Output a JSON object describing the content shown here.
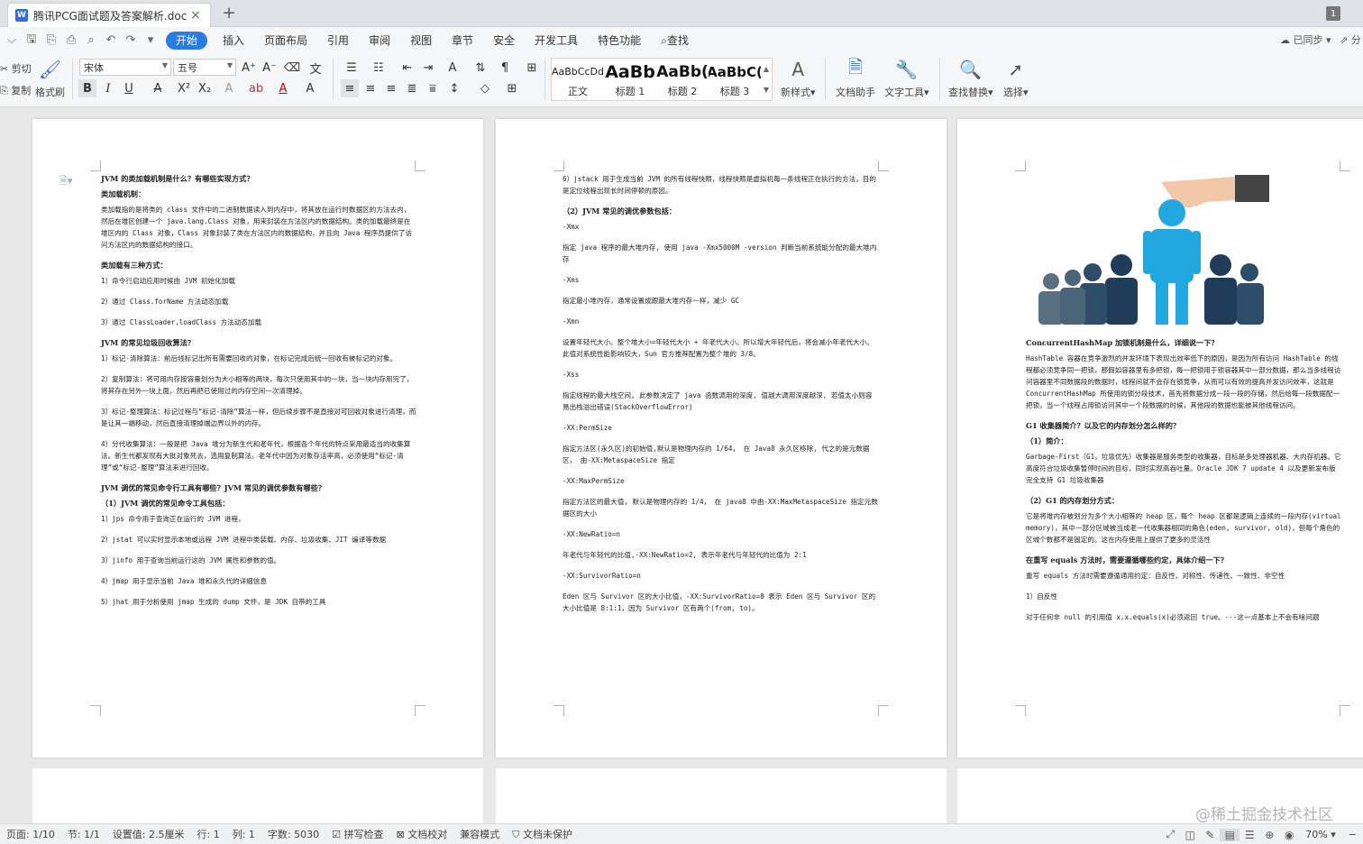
{
  "tab": {
    "title": "腾讯PCG面试题及答案解析.doc",
    "close": "×",
    "add": "+",
    "window_count": "1"
  },
  "menu": {
    "items": [
      "开始",
      "插入",
      "页面布局",
      "引用",
      "审阅",
      "视图",
      "章节",
      "安全",
      "开发工具",
      "特色功能"
    ],
    "search": "查找",
    "sync": "已同步",
    "share": "分"
  },
  "ribbon": {
    "cut": "剪切",
    "copy": "复制",
    "format_painter": "格式刷",
    "font_name": "宋体",
    "font_size": "五号",
    "styles": [
      {
        "preview": "AaBbCcDd",
        "label": "正文"
      },
      {
        "preview": "AaBb",
        "label": "标题 1"
      },
      {
        "preview": "AaBb(",
        "label": "标题 2"
      },
      {
        "preview": "AaBbC(",
        "label": "标题 3"
      }
    ],
    "new_style": "新样式",
    "doc_assistant": "文档助手",
    "text_tools": "文字工具",
    "find_replace": "查找替换",
    "select": "选择"
  },
  "page1": [
    {
      "h": "JVM 的类加载机制是什么？有哪些实现方式？"
    },
    {
      "h": "类加载机制："
    },
    {
      "t": "类加载指的是将类的 class 文件中的二进制数据读入到内存中，将其放在运行时数据区的方法去内，然后在堆区创建一个 java.lang.Class 对象，用来封装在方法区内的数据结构。类的加载最终是在堆区内的 Class 对象，Class 对象封装了类在方法区内的数据结构，并且向 Java 程序员提供了访问方法区内的数据结构的接口。"
    },
    {
      "h": "类加载有三种方式："
    },
    {
      "t": "1）命令行启动应用时候由 JVM 初始化加载"
    },
    {
      "t": "2）通过 Class.forName 方法动态加载"
    },
    {
      "t": "3）通过 ClassLoader.loadClass 方法动态加载"
    },
    {
      "h": "JVM 的常见垃圾回收算法？"
    },
    {
      "t": "1）标记-清除算法：前后线标记出所有需要回收的对象，在标记完成后统一回收有被标记的对象。"
    },
    {
      "t": "2）复制算法：将可用内存按容量划分为大小相等的两块，每次只使用其中的一块，当一块内存用完了，将其存在另外一块上面，然后再把已使用过的内存空间一次清理掉。"
    },
    {
      "t": "3）标记-整理算法：标记过程与“标记-清除”算法一样，但后续步骤不是直接对可回收对象进行清理，而是让其一端移动，然后直接清理掉端边界以外的内存。"
    },
    {
      "t": "4）分代收集算法：一般是把 Java 堆分为新生代和老年代，根据各个年代的特点采用最适当的收集算法。新生代都发现有大批对象死去，选用复制算法。老年代中因为对象存活率高，必须使用“标记-清理”或“标记-整理”算法来进行回收。"
    },
    {
      "h": "JVM 调优的常见命令行工具有哪些？JVM 常见的调优参数有哪些？"
    },
    {
      "h": "（1）JVM 调优的常见命令工具包括："
    },
    {
      "t": "1）jps 命令用于查询正在运行的 JVM 进程，"
    },
    {
      "t": "2）jstat 可以实时显示本地或远程 JVM 进程中类装载、内存、垃圾收集、JIT 编译等数据"
    },
    {
      "t": "3）jinfo 用于查询当前运行这的 JVM 属性和参数的值。"
    },
    {
      "t": "4）jmap 用于显示当前 Java 堆和永久代的详细信息"
    },
    {
      "t": "5）jhat 用于分析使用 jmap 生成的 dump 文件，是 JDK 自带的工具"
    }
  ],
  "page2": [
    {
      "t": "6）jstack 用于生成当前 JVM 的所有线程快照，线程快照是虚拟机每一条线程正在执行的方法，目的是定位线程出现长时间停顿的原因。"
    },
    {
      "h": "（2）JVM 常见的调优参数包括："
    },
    {
      "t": "-Xmx"
    },
    {
      "t": "指定 java 程序的最大堆内存, 使用 java -Xmx5000M -version 判断当前系统能分配的最大堆内存"
    },
    {
      "t": "-Xms"
    },
    {
      "t": "指定最小堆内存，通常设置成跟最大堆内存一样，减少 GC"
    },
    {
      "t": "-Xmn"
    },
    {
      "t": "设置年轻代大小。整个堆大小=年轻代大小 + 年老代大小。所以增大年轻代后，将会减小年老代大小。此值对系统性能影响较大，Sun 官方推荐配置为整个堆的 3/8。"
    },
    {
      "t": "-Xss"
    },
    {
      "t": "指定线程的最大栈空间, 此参数决定了 java 函数调用的深度, 值越大调用深度越深, 若值太小则容易出栈溢出错误(StackOverflowError)"
    },
    {
      "t": "-XX:PermSize"
    },
    {
      "t": "指定方法区(永久区)的初始值,默认是物理内存的 1/64， 在 Java8 永久区移除, 代之的是元数据区， 由-XX:MetaspaceSize 指定"
    },
    {
      "t": "-XX:MaxPermSize"
    },
    {
      "t": "指定方法区的最大值, 默认是物理内存的 1/4， 在 java8 中由-XX:MaxMetaspaceSize 指定元数据区的大小"
    },
    {
      "t": "-XX:NewRatio=n"
    },
    {
      "t": "年老代与年轻代的比值,-XX:NewRatio=2, 表示年老代与年轻代的比值为 2:1"
    },
    {
      "t": "-XX:SurvivorRatio=n"
    },
    {
      "t": "Eden 区与 Survivor 区的大小比值，-XX:SurvivorRatio=8 表示 Eden 区与 Survivor 区的大小比值是 8:1:1，因为 Survivor 区有两个(from, to)。"
    }
  ],
  "page3": [
    {
      "h": "ConcurrentHashMap 加锁机制是什么，详细说一下？"
    },
    {
      "t": "HashTable 容器在竞争激烈的并发环境下表现出效率低下的原因，是因为所有访问 HashTable 的线程都必须竞争同一把锁，那假如容器里有多把锁，每一把锁用于锁容器其中一部分数据，那么当多线程访问容器里不同数据段的数据时，线程间就不会存在锁竞争，从而可以有效的提高并发访问效率，这就是 ConcurrentHashMap 所使用的锁分段技术，首先将数据分成一段一段的存储，然后给每一段数据配一把锁，当一个线程占用锁访问其中一个段数据的时候，其他段的数据也能被其他线程访问。"
    },
    {
      "h": "G1 收集器简介？以及它的内存划分怎么样的？"
    },
    {
      "h": "（1）简介："
    },
    {
      "t": "Garbage-First（G1，垃圾优先）收集器是服务类型的收集器，目标是多处理器机器、大内存机器。它高度符合垃圾收集暂停时间的目标，同时实现高吞吐量。Oracle JDK 7 update 4 以及更新发布版完全支持 G1 垃圾收集器"
    },
    {
      "h": "（2）G1 的内存划分方式："
    },
    {
      "t": "它是将堆内存被划分为多个大小相等的 heap 区，每个 heap 区都是逻辑上连续的一段内存(virtual memory)，其中一部分区域被当成老一代收集器相同的角色(eden, survivor, old)，但每个角色的区域个数都不是固定的。这在内存使用上提供了更多的灵活性"
    },
    {
      "h": "在重写 equals 方法时，需要遵循哪些约定，具体介绍一下？"
    },
    {
      "t": "重写 equals 方法时需要遵循通用约定：自反性、对称性、传递性、一致性、非空性"
    },
    {
      "t": "1）自反性"
    },
    {
      "t": "对于任何非 null 的引用值 x,x.equals(x)必须返回 true。---这一点基本上不会有啥问题"
    }
  ],
  "status": {
    "page": "页面: 1/10",
    "section": "节: 1/1",
    "setting": "设置值: 2.5厘米",
    "row": "行: 1",
    "col": "列: 1",
    "words": "字数: 5030",
    "spell": "拼写检查",
    "proof": "文档校对",
    "compat": "兼容模式",
    "protect": "文档未保护",
    "zoom": "70%",
    "zoom_minus": "−"
  },
  "watermark": "@稀土掘金技术社区"
}
